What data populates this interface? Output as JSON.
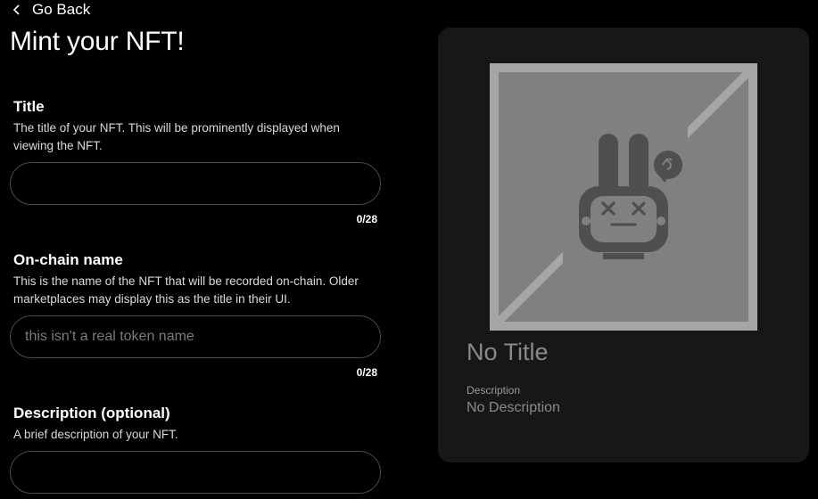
{
  "nav": {
    "back_label": "Go Back",
    "back_icon": "chevron-left-icon"
  },
  "page": {
    "title": "Mint your NFT!"
  },
  "form": {
    "title_field": {
      "label": "Title",
      "help": "The title of your NFT. This will be prominently displayed when viewing the NFT.",
      "value": "",
      "placeholder": "",
      "counter": "0/28"
    },
    "onchain_field": {
      "label": "On-chain name",
      "help": "This is the name of the NFT that will be recorded on-chain. Older marketplaces may display this as the title in their UI.",
      "value": "",
      "placeholder": "this isn't a real token name",
      "counter": "0/28"
    },
    "description_field": {
      "label": "Description (optional)",
      "help": "A brief description of your NFT.",
      "value": "",
      "placeholder": ""
    }
  },
  "preview": {
    "image_icon": "placeholder-bunny-icon",
    "title": "No Title",
    "description_label": "Description",
    "description": "No Description"
  },
  "colors": {
    "background": "#000000",
    "card": "#171717",
    "input_border": "#4a4a4a",
    "placeholder_bg": "#808080",
    "placeholder_frame": "#a6a6a6",
    "muted_text": "#8a8a8a"
  }
}
